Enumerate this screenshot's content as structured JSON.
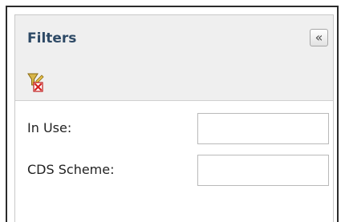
{
  "panel": {
    "title": "Filters",
    "collapse_glyph": "«",
    "collapse_icon": "double-chevron-left-icon",
    "clear_filter_icon": "clear-filter-icon"
  },
  "fields": [
    {
      "label": "In Use:",
      "value": "",
      "placeholder": ""
    },
    {
      "label": "CDS Scheme:",
      "value": "",
      "placeholder": ""
    }
  ],
  "colors": {
    "title_text": "#2e4a66",
    "header_bg": "#efefef",
    "icon_funnel": "#b08a1a",
    "icon_clear": "#d42020"
  }
}
